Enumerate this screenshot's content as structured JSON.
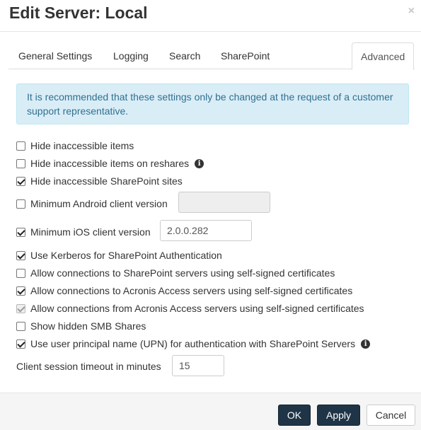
{
  "dialog": {
    "title": "Edit Server: Local",
    "close_glyph": "×"
  },
  "tabs": [
    {
      "label": "General Settings"
    },
    {
      "label": "Logging"
    },
    {
      "label": "Search"
    },
    {
      "label": "SharePoint"
    },
    {
      "label": "Advanced",
      "active": true
    }
  ],
  "alert": {
    "text": "It is recommended that these settings only be changed at the request of a customer support representative."
  },
  "settings": {
    "hide_inaccessible_items": {
      "label": "Hide inaccessible items",
      "checked": false
    },
    "hide_inaccessible_reshares": {
      "label": "Hide inaccessible items on reshares",
      "checked": false,
      "info_icon": "info-icon"
    },
    "hide_inaccessible_sharepoint": {
      "label": "Hide inaccessible SharePoint sites",
      "checked": true
    },
    "min_android": {
      "label": "Minimum Android client version",
      "checked": false,
      "value": ""
    },
    "min_ios": {
      "label": "Minimum iOS client version",
      "checked": true,
      "value": "2.0.0.282"
    },
    "kerberos": {
      "label": "Use Kerberos for SharePoint Authentication",
      "checked": true
    },
    "sp_self_signed": {
      "label": "Allow connections to SharePoint servers using self-signed certificates",
      "checked": false
    },
    "to_acronis_self_signed": {
      "label": "Allow connections to Acronis Access servers using self-signed certificates",
      "checked": true
    },
    "from_acronis_self_signed": {
      "label": "Allow connections from Acronis Access servers using self-signed certificates",
      "checked": true,
      "disabled": true
    },
    "hidden_smb": {
      "label": "Show hidden SMB Shares",
      "checked": false
    },
    "upn": {
      "label": "Use user principal name (UPN) for authentication with SharePoint Servers",
      "checked": true,
      "info_icon": "info-icon"
    },
    "session_timeout": {
      "label": "Client session timeout in minutes",
      "value": "15"
    }
  },
  "footer": {
    "ok_label": "OK",
    "apply_label": "Apply",
    "cancel_label": "Cancel"
  },
  "colors": {
    "primary_button": "#1f3547",
    "alert_bg": "#d9edf7",
    "alert_text": "#31708f"
  }
}
